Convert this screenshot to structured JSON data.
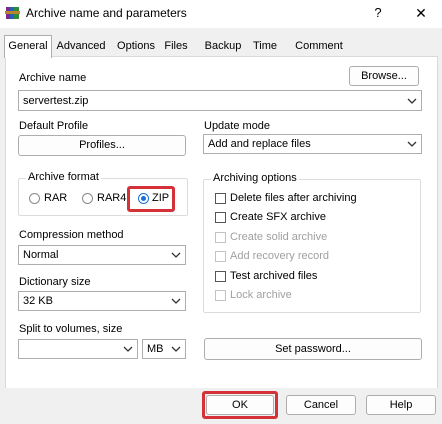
{
  "window": {
    "title": "Archive name and parameters",
    "help": "?",
    "close": "✕"
  },
  "tabs": [
    "General",
    "Advanced",
    "Options",
    "Files",
    "Backup",
    "Time",
    "Comment"
  ],
  "general": {
    "archive_name_label": "Archive name",
    "archive_name_value": "servertest.zip",
    "browse_label": "Browse...",
    "default_profile_label": "Default Profile",
    "profiles_label": "Profiles...",
    "update_mode_label": "Update mode",
    "update_mode_value": "Add and replace files",
    "archive_format_label": "Archive format",
    "formats": [
      "RAR",
      "RAR4",
      "ZIP"
    ],
    "selected_format": "ZIP",
    "compression_label": "Compression method",
    "compression_value": "Normal",
    "dictionary_label": "Dictionary size",
    "dictionary_value": "32 KB",
    "split_label": "Split to volumes, size",
    "split_value": "",
    "split_unit": "MB",
    "archiving_options_label": "Archiving options",
    "options": [
      {
        "label": "Delete files after archiving",
        "checked": false,
        "enabled": true
      },
      {
        "label": "Create SFX archive",
        "checked": false,
        "enabled": true
      },
      {
        "label": "Create solid archive",
        "checked": false,
        "enabled": false
      },
      {
        "label": "Add recovery record",
        "checked": false,
        "enabled": false
      },
      {
        "label": "Test archived files",
        "checked": false,
        "enabled": true
      },
      {
        "label": "Lock archive",
        "checked": false,
        "enabled": false
      }
    ],
    "set_password_label": "Set password..."
  },
  "footer": {
    "ok": "OK",
    "cancel": "Cancel",
    "help": "Help"
  },
  "colors": {
    "highlight": "#d43138",
    "accent": "#1b6fd8"
  },
  "icons": {
    "app": "winrar-books-icon",
    "dropdown": "chevron-down-icon"
  }
}
